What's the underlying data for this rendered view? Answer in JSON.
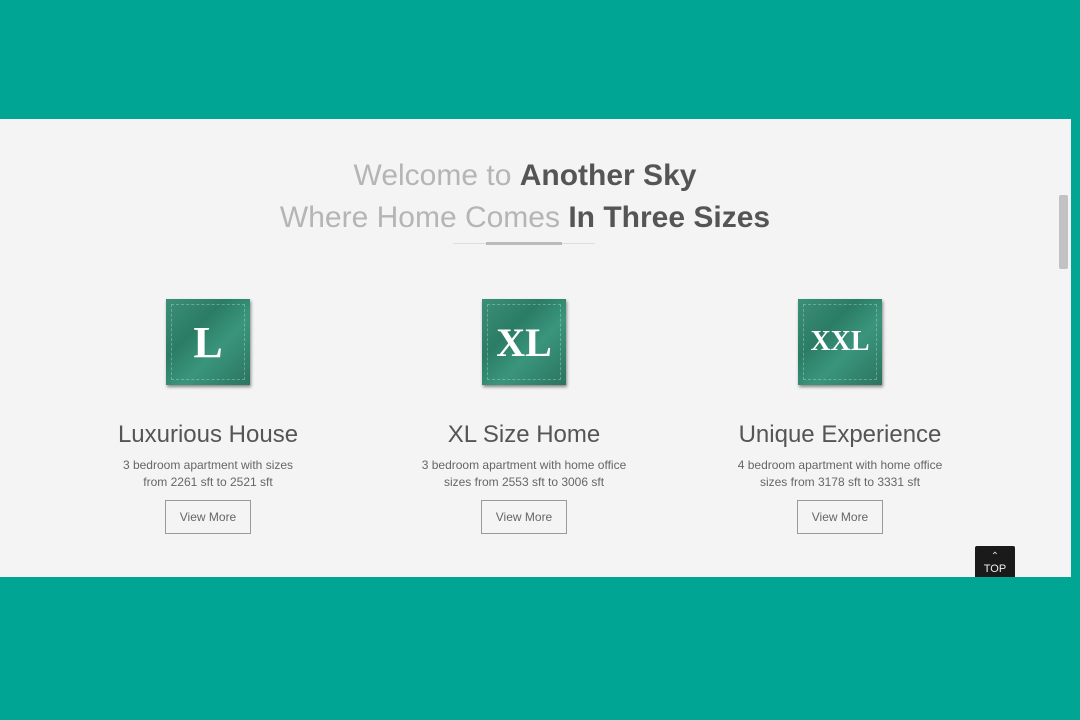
{
  "heading": {
    "line1_light": "Welcome to",
    "line1_strong": "Another Sky",
    "line2_light": "Where Home Comes",
    "line2_strong": "In Three Sizes"
  },
  "cards": [
    {
      "badge": "L",
      "title": "Luxurious House",
      "desc_line1": "3 bedroom apartment with sizes",
      "desc_line2": "from 2261 sft to 2521 sft",
      "button": "View More"
    },
    {
      "badge": "XL",
      "title": "XL Size Home",
      "desc_line1": "3 bedroom apartment with home office",
      "desc_line2": "sizes from 2553 sft to 3006 sft",
      "button": "View More"
    },
    {
      "badge": "XXL",
      "title": "Unique Experience",
      "desc_line1": "4 bedroom apartment with home office",
      "desc_line2": "sizes from 3178 sft to 3331 sft",
      "button": "View More"
    }
  ],
  "back_to_top": {
    "icon": "chevron-up-icon",
    "label": "TOP"
  },
  "colors": {
    "background_frame": "#00a693",
    "page_background": "#f4f4f4",
    "badge_green": "#2f8a72"
  }
}
